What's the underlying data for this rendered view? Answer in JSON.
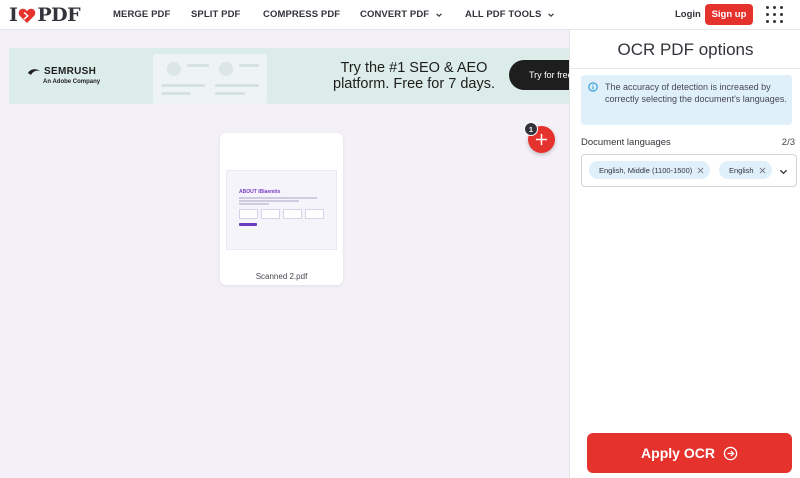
{
  "header": {
    "logo_left": "I",
    "logo_right": "PDF",
    "nav": [
      "MERGE PDF",
      "SPLIT PDF",
      "COMPRESS PDF",
      "CONVERT PDF",
      "ALL PDF TOOLS"
    ],
    "login": "Login",
    "signup": "Sign up"
  },
  "ad": {
    "brand": "SEMRUSH",
    "brand_sub": "An Adobe Company",
    "headline_1": "Try the #1 SEO & AEO",
    "headline_2": "platform. Free for 7 days.",
    "cta": "Try for free"
  },
  "workspace": {
    "file_count": "1",
    "file_name": "Scanned 2.pdf",
    "thumb_title": "ABOUT iBlaemits"
  },
  "panel": {
    "title": "OCR PDF options",
    "info": "The accuracy of detection is increased by correctly selecting the document's languages.",
    "languages_label": "Document languages",
    "languages_count": "2/3",
    "languages": [
      "English, Middle (1100-1500)",
      "English"
    ],
    "apply": "Apply OCR"
  },
  "colors": {
    "brand_red": "#e5322d",
    "info_bg": "#dff0fb",
    "ad_bg": "#dcece9"
  }
}
